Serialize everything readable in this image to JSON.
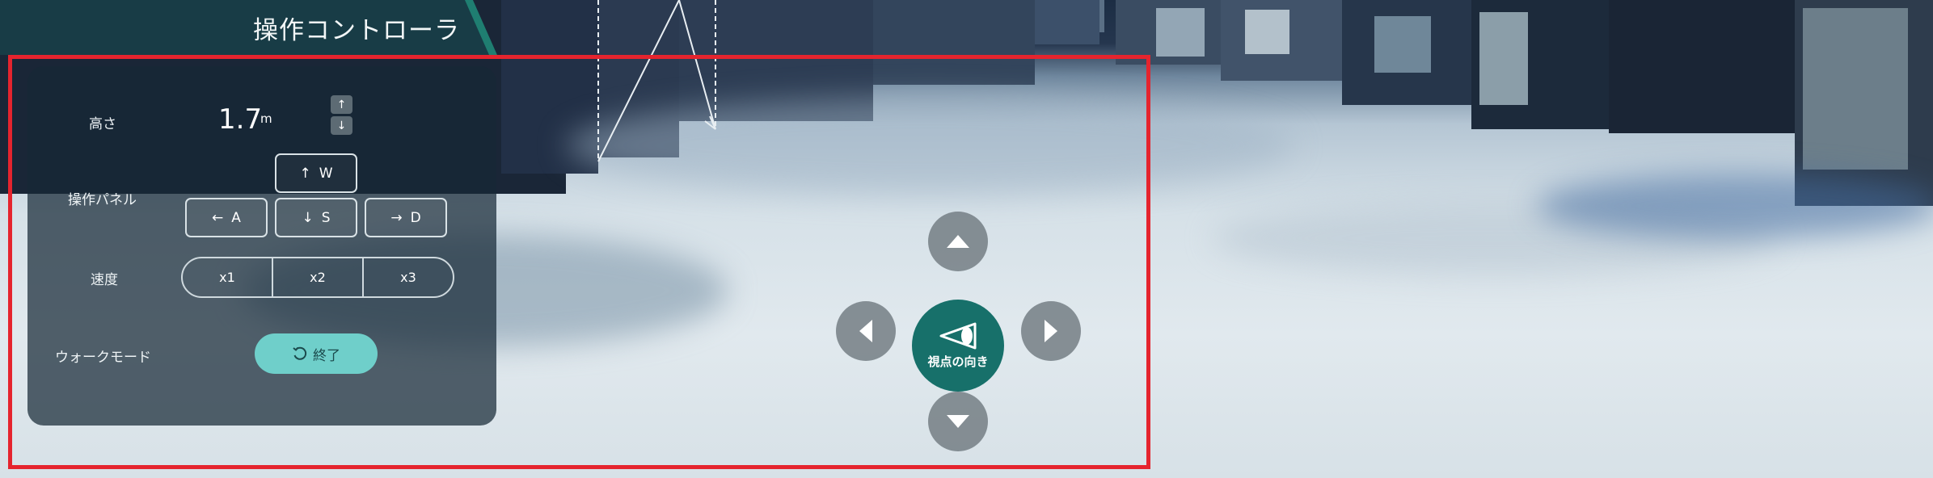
{
  "panel": {
    "title": "操作コントローラ",
    "height": {
      "label": "高さ",
      "value": "1.7",
      "unit": "m",
      "up_icon": "arrow-up-icon",
      "down_icon": "arrow-down-icon"
    },
    "controls": {
      "label": "操作パネル",
      "keys": [
        {
          "arrow": "↑",
          "key": "W"
        },
        {
          "arrow": "←",
          "key": "A"
        },
        {
          "arrow": "↓",
          "key": "S"
        },
        {
          "arrow": "→",
          "key": "D"
        }
      ]
    },
    "speed": {
      "label": "速度",
      "options": [
        "x1",
        "x2",
        "x3"
      ]
    },
    "walk_mode": {
      "label": "ウォークモード",
      "button_label": "終了",
      "button_icon": "rotate-ccw-icon"
    }
  },
  "view_pad": {
    "center_label": "視点の向き",
    "center_icon": "eye-view-icon",
    "icons": [
      "triangle-up-icon",
      "triangle-left-icon",
      "triangle-right-icon",
      "triangle-down-icon"
    ]
  },
  "colors": {
    "panel_bg": "#162836",
    "title_bar": "#183c46",
    "accent_teal": "#1f7e71",
    "end_button": "#6fcfca",
    "dpad_center": "#17706a",
    "selection_frame": "#e5242e"
  }
}
